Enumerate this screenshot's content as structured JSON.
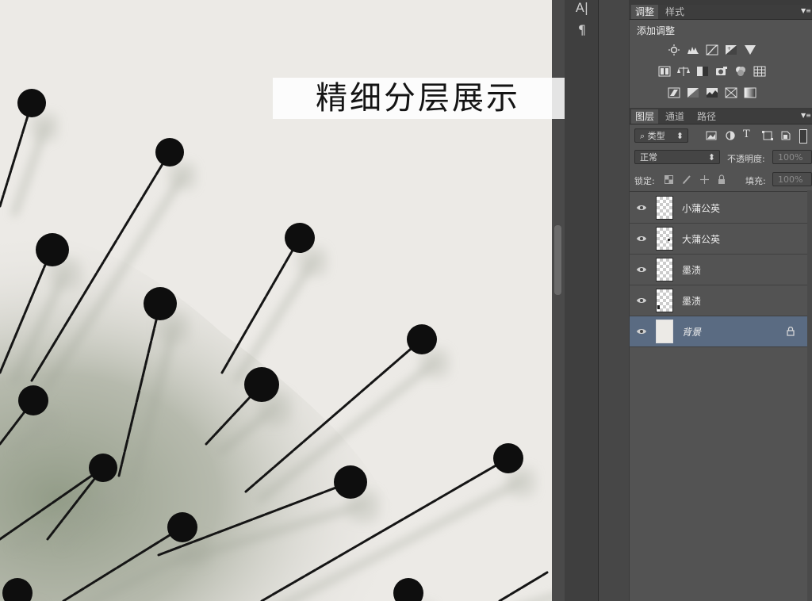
{
  "canvas": {
    "title_text": "精细分层展示"
  },
  "dock": {
    "buttons": [
      {
        "label": "A|",
        "icon": "character-panel-icon"
      },
      {
        "label": "¶",
        "icon": "paragraph-panel-icon"
      }
    ]
  },
  "adjustments_panel": {
    "tabs": [
      "调整",
      "样式"
    ],
    "active_tab": "调整",
    "heading": "添加调整",
    "icons": [
      "brightness-contrast-icon",
      "levels-icon",
      "curves-icon",
      "exposure-icon",
      "vibrance-icon",
      "hue-saturation-icon",
      "color-balance-icon",
      "black-white-icon",
      "photo-filter-icon",
      "channel-mixer-icon",
      "color-lookup-icon",
      "invert-icon",
      "posterize-icon",
      "threshold-icon",
      "selective-color-icon",
      "gradient-map-icon"
    ]
  },
  "layers_panel": {
    "tabs": [
      "图层",
      "通道",
      "路径"
    ],
    "active_tab": "图层",
    "filter_label": "类型",
    "blend_mode": "正常",
    "opacity_label": "不透明度:",
    "opacity_value": "100%",
    "lock_label": "锁定:",
    "fill_label": "填充:",
    "fill_value": "100%",
    "layers": [
      {
        "name": "小蒲公英",
        "visible": true,
        "locked": false,
        "selected": false,
        "thumb": "transparent"
      },
      {
        "name": "大蒲公英",
        "visible": true,
        "locked": false,
        "selected": false,
        "thumb": "transparent-dot"
      },
      {
        "name": "墨渍",
        "visible": true,
        "locked": false,
        "selected": false,
        "thumb": "transparent"
      },
      {
        "name": "墨渍",
        "visible": true,
        "locked": false,
        "selected": false,
        "thumb": "transparent-mark"
      },
      {
        "name": "背景",
        "visible": true,
        "locked": true,
        "selected": true,
        "thumb": "paper"
      }
    ]
  },
  "colors": {
    "selected_layer": "#5a6b82",
    "panel_bg": "#535353",
    "paper": "#eceae6",
    "ink": "#111111"
  }
}
